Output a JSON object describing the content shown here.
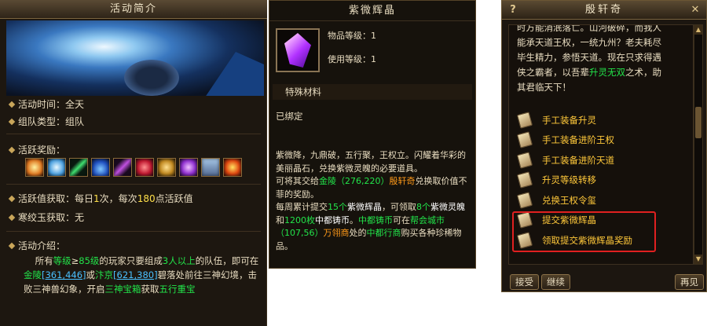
{
  "activity_panel": {
    "title": "活动简介",
    "time_label": "活动时间：",
    "time_value": "全天",
    "team_label": "组队类型：",
    "team_value": "组队",
    "rewards_label": "活跃奖励：",
    "reward_icons": [
      "orb-icon",
      "blue-crystal-icon",
      "green-staff-icon",
      "blue-flask-icon",
      "purple-feather-icon",
      "red-gem-icon",
      "gold-armor-icon",
      "purple-crystal-icon",
      "scroll-icon",
      "fire-chest-icon"
    ],
    "activity_label": "活跃值获取：",
    "activity_value": {
      "p1": "每日",
      "n1": "1",
      "p2": "次，每次",
      "n2": "180",
      "p3": "点活跃值"
    },
    "jade_label": "寒绞玉获取：",
    "jade_value": "无",
    "intro_label": "活动介绍：",
    "intro": {
      "t1": "所有",
      "level": "等级",
      "t2": "≥",
      "lvl85": "85级",
      "t3": "的玩家只要组成",
      "people": "3人以上",
      "t4": "的队伍，即可在",
      "jinling": "金陵",
      "coord1": "[361,446]",
      "t5": "或",
      "bianjing": "汴京",
      "coord2": "[621,380]",
      "t6": "碧落处前往三神幻境，击败三神兽幻象，开启",
      "chest": "三神宝箱",
      "t7": "获取",
      "treasure": "五行重宝"
    }
  },
  "item_tooltip": {
    "title": "紫微辉晶",
    "item_level": "物品等级：1",
    "use_level": "使用等级：1",
    "category": "特殊材料",
    "bound": "已绑定",
    "desc": {
      "d1": "紫微降，九鼎破，五行聚，王权立。闪耀着华彩的美丽晶石，兑换紫微灵魄的必要道具。",
      "d2": "可将其交给",
      "jinling": "金陵",
      "coord": "（276,220）",
      "npc": "殷轩奇",
      "d3": "兑换取价值不菲的奖励。",
      "d4": "每周累计提交",
      "n15": "15个",
      "item1": "紫微辉晶",
      "d5": "，可领取",
      "n8": "8个",
      "item2": "紫微灵魄",
      "d6": "和",
      "n1200": "1200枚",
      "coin": "中都铸币",
      "d7": "。",
      "coin2": "中都铸币",
      "d8": "可在",
      "city": "帮会城市",
      "coord2": "（107,56）",
      "merchant": "万翎商",
      "d9": "处的",
      "shop": "中都行商",
      "d10": "购买各种珍稀物品。"
    }
  },
  "npc_dialog": {
    "title": "殷轩奇",
    "help_glyph": "?",
    "close_glyph": "✕",
    "dialog_lines": {
      "l1": "时方能消泯落亡。山河破碎，而我人",
      "l2": "能承天道王权，一统九州？老夫耗尽",
      "l3": "毕生精力，参悟天道。现在只求得遇",
      "l4a": "侠之霸者，以吾辈",
      "l4b": "升灵无双",
      "l4c": "之术，助",
      "l5": "其君临天下！"
    },
    "options": [
      "手工装备升灵",
      "手工装备进阶王权",
      "手工装备进阶天道",
      "升灵等级转移",
      "兑换王权令玺",
      "提交紫微辉晶",
      "领取提交紫微辉晶奖励"
    ],
    "accept_button": "接受",
    "continue_button": "继续",
    "goodbye_button": "再见",
    "highlight_color": "#e02020"
  }
}
